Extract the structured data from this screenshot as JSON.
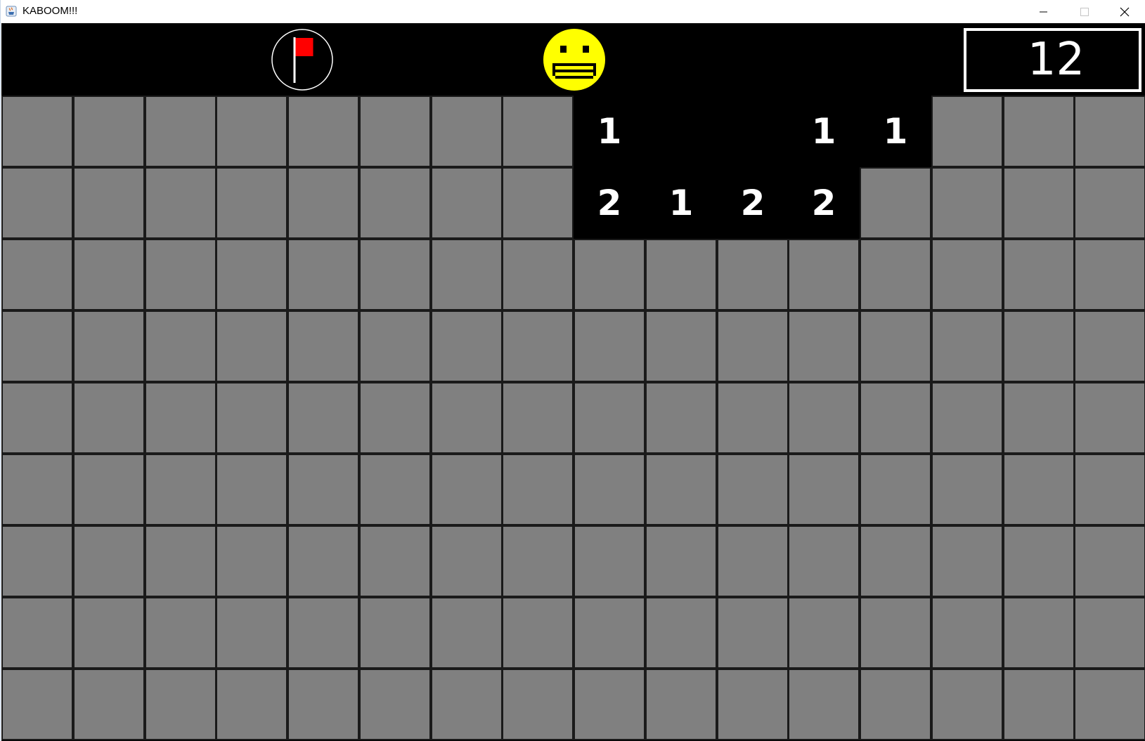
{
  "window": {
    "title": "KABOOM!!!",
    "controls": {
      "minimize_icon": "minimize-icon",
      "maximize_icon": "maximize-icon",
      "close_icon": "close-icon"
    }
  },
  "hud": {
    "flag_mode_icon": "flag-icon",
    "face_icon": "smiley-face-icon",
    "counter": "12"
  },
  "board": {
    "columns": 16,
    "rows": 9,
    "cells": [
      [
        "H",
        "H",
        "H",
        "H",
        "H",
        "H",
        "H",
        "H",
        "1",
        "",
        "",
        "1",
        "1",
        "H",
        "H",
        "H"
      ],
      [
        "H",
        "H",
        "H",
        "H",
        "H",
        "H",
        "H",
        "H",
        "2",
        "1",
        "2",
        "2",
        "H",
        "H",
        "H",
        "H"
      ],
      [
        "H",
        "H",
        "H",
        "H",
        "H",
        "H",
        "H",
        "H",
        "H",
        "H",
        "H",
        "H",
        "H",
        "H",
        "H",
        "H"
      ],
      [
        "H",
        "H",
        "H",
        "H",
        "H",
        "H",
        "H",
        "H",
        "H",
        "H",
        "H",
        "H",
        "H",
        "H",
        "H",
        "H"
      ],
      [
        "H",
        "H",
        "H",
        "H",
        "H",
        "H",
        "H",
        "H",
        "H",
        "H",
        "H",
        "H",
        "H",
        "H",
        "H",
        "H"
      ],
      [
        "H",
        "H",
        "H",
        "H",
        "H",
        "H",
        "H",
        "H",
        "H",
        "H",
        "H",
        "H",
        "H",
        "H",
        "H",
        "H"
      ],
      [
        "H",
        "H",
        "H",
        "H",
        "H",
        "H",
        "H",
        "H",
        "H",
        "H",
        "H",
        "H",
        "H",
        "H",
        "H",
        "H"
      ],
      [
        "H",
        "H",
        "H",
        "H",
        "H",
        "H",
        "H",
        "H",
        "H",
        "H",
        "H",
        "H",
        "H",
        "H",
        "H",
        "H"
      ],
      [
        "H",
        "H",
        "H",
        "H",
        "H",
        "H",
        "H",
        "H",
        "H",
        "H",
        "H",
        "H",
        "H",
        "H",
        "H",
        "H"
      ]
    ]
  },
  "colors": {
    "hidden_cell": "#808080",
    "revealed_cell": "#000000",
    "number_text": "#ffffff",
    "smiley": "#ffff00",
    "flag": "#ff0000"
  }
}
